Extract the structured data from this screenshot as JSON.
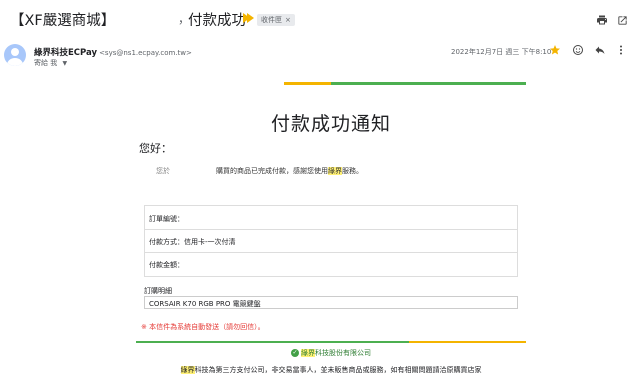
{
  "header": {
    "subject_part1": "【XF嚴選商城】",
    "comma": "，",
    "subject_part2": "付款成功",
    "label": "收件匣",
    "label_close": "×",
    "print_icon": "printer-icon",
    "popout_icon": "open-in-new-icon"
  },
  "sender": {
    "name": "綠界科技ECPay",
    "address": "<sys@ns1.ecpay.com.tw>",
    "to_text": "寄給 我",
    "date": "2022年12月7日 週三 下午8:10"
  },
  "email": {
    "title": "付款成功通知",
    "greeting": "您好：",
    "msg_prefix": "您於",
    "msg_body": "購買的商品已完成付款，感謝您使用",
    "msg_brand": "綠界",
    "msg_suffix": "服務。",
    "order_no_label": "訂單編號：",
    "payment_method_label": "付款方式：信用卡-一次付清",
    "amount_label": "付款金額：",
    "detail_label": "訂購明細",
    "detail_item": "CORSAIR K70 RGB PRO 電競鍵盤",
    "notice": "※ 本信件為系統自動發送（請勿回信）。",
    "company_brand": "綠界",
    "company_rest": "科技股份有限公司",
    "footer_brand": "綠界",
    "footer_rest": "科技為第三方支付公司，非交易當事人，並未販售商品或服務，如有相關問題請洽原購買店家"
  },
  "colors": {
    "accent_yellow": "#f4b400",
    "accent_green": "#4caf50",
    "notice_red": "#e53935",
    "highlight": "#fff176"
  }
}
